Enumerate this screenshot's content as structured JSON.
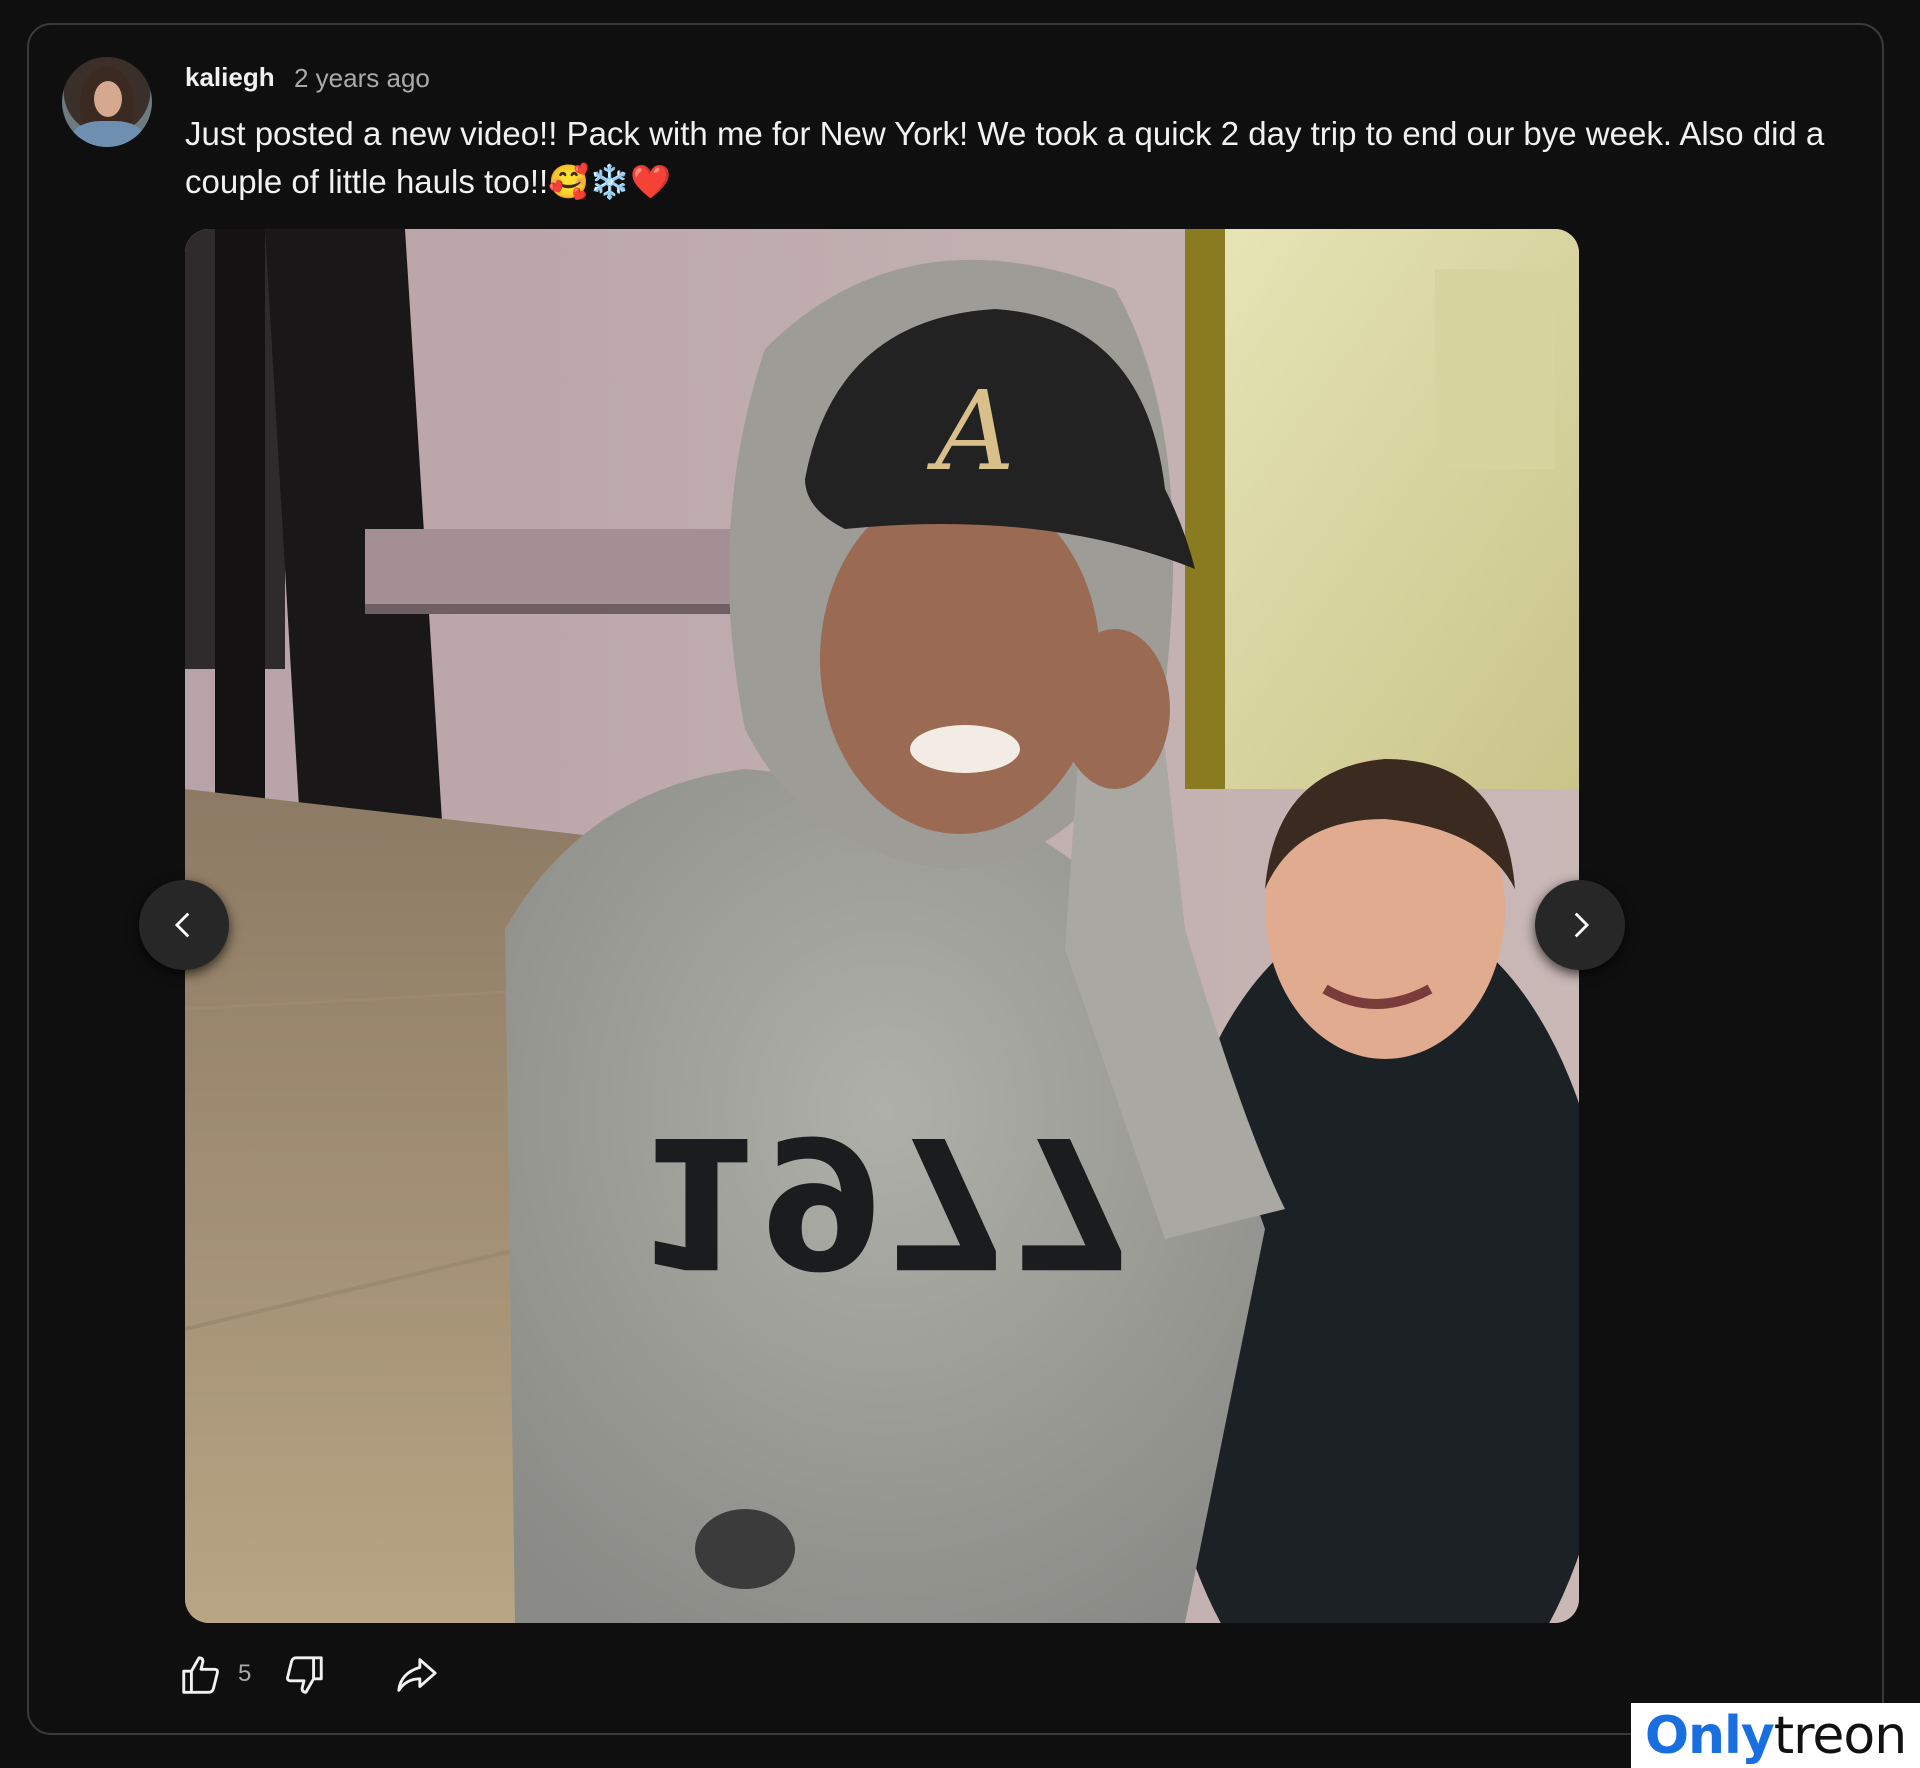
{
  "post": {
    "author": "kaliegh",
    "timestamp": "2 years ago",
    "text": "Just posted a new video!! Pack with me for New York! We took a quick 2 day trip to end our bye week. Also did a couple of little hauls too!!🥰❄️❤️",
    "image": {
      "sweatshirt_print": "1977",
      "cap_logo": "A"
    },
    "like_count": "5"
  },
  "icons": {
    "prev": "chevron-left-icon",
    "next": "chevron-right-icon",
    "gallery": "gallery-icon",
    "like": "thumbs-up-icon",
    "dislike": "thumbs-down-icon",
    "share": "share-icon"
  },
  "watermark": {
    "part1": "Only",
    "part2": "treon"
  },
  "colors": {
    "background": "#0f0f0f",
    "card_border": "#3a3a3a",
    "text_primary": "#f1f1f1",
    "text_secondary": "#aaaaaa",
    "nav_button": "#272727",
    "watermark_blue": "#1a6fe0"
  }
}
